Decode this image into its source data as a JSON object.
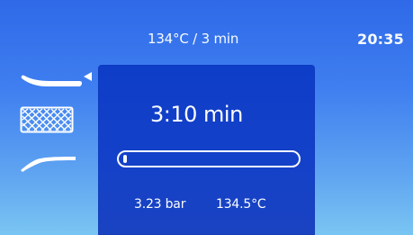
{
  "header": {
    "program_label": "134°C / 3 min",
    "clock_label": "20:35"
  },
  "status_panel": {
    "remaining_time_label": "3:10  min",
    "progress_fraction": 0.02,
    "pressure_label": "3.23  bar",
    "temperature_label": "134.5°C"
  },
  "left_icons": [
    {
      "name": "handpiece-icon",
      "selected": true
    },
    {
      "name": "mesh-tray-icon",
      "selected": false
    },
    {
      "name": "curved-instrument-icon",
      "selected": false
    }
  ],
  "colors": {
    "background_top": "#2f69e8",
    "background_bottom": "#79c5f2",
    "panel": "#1441c9",
    "foreground": "#ffffff"
  }
}
